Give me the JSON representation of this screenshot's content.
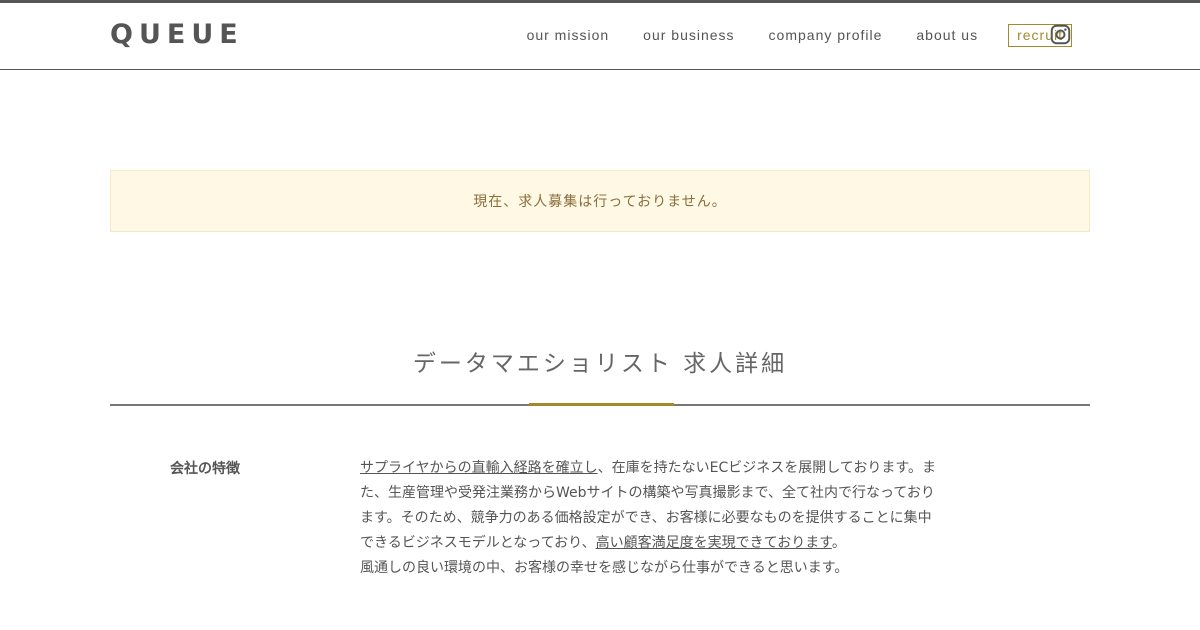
{
  "header": {
    "logo": "QUEUE",
    "nav": [
      {
        "label": "our mission"
      },
      {
        "label": "our business"
      },
      {
        "label": "company profile"
      },
      {
        "label": "about us"
      }
    ],
    "recruit_label": "recruit",
    "instagram_icon": "instagram-icon"
  },
  "notice": {
    "text": "現在、求人募集は行っておりません。"
  },
  "job": {
    "title": "データマエショリスト 求人詳細",
    "feature_label": "会社の特徴",
    "feature_body": {
      "link1": "サプライヤからの直輸入経路を確立し",
      "text1": "、在庫を持たないECビジネスを展開しております。また、生産管理や受発注業務からWebサイトの構築や写真撮影まで、全て社内で行なっております。そのため、競争力のある価格設定ができ、お客様に必要なものを提供することに集中できるビジネスモデルとなっており、",
      "link2": "高い顧客満足度を実現できております",
      "text2": "。",
      "line2": "風通しの良い環境の中、お客様の幸せを感じながら仕事ができると思います。"
    }
  },
  "colors": {
    "accent": "#a38b2c",
    "notice_bg": "#fef8e4",
    "notice_text": "#8a6d3b",
    "text": "#555555"
  }
}
